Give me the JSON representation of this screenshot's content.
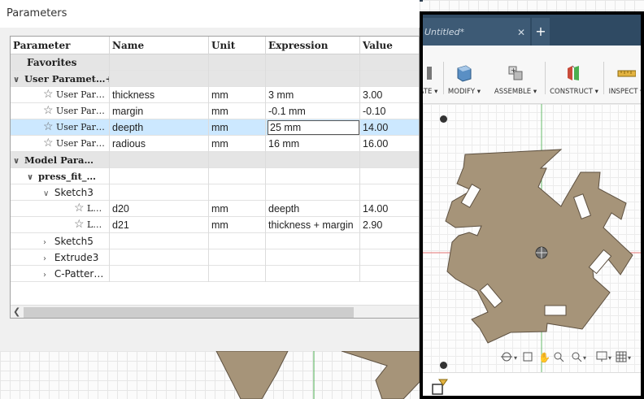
{
  "dialog": {
    "title": "Parameters",
    "columns": [
      "Parameter",
      "Name",
      "Unit",
      "Expression",
      "Value"
    ],
    "groups": {
      "favorites": "Favorites",
      "user_parameters": "User Paramet…",
      "model_parameters": "Model Para…",
      "component": "press_fit_…",
      "sketch3": "Sketch3",
      "sketch5": "Sketch5",
      "extrude3": "Extrude3",
      "cpattern": "C-Patter…"
    },
    "user_params": [
      {
        "param": "User Par…",
        "name": "thickness",
        "unit": "mm",
        "expression": "3 mm",
        "value": "3.00"
      },
      {
        "param": "User Par…",
        "name": "margin",
        "unit": "mm",
        "expression": "-0.1 mm",
        "value": "-0.10"
      },
      {
        "param": "User Par…",
        "name": "deepth",
        "unit": "mm",
        "expression": "25 mm",
        "value": "14.00"
      },
      {
        "param": "User Par…",
        "name": "radious",
        "unit": "mm",
        "expression": "16 mm",
        "value": "16.00"
      }
    ],
    "model_params": [
      {
        "param": "L…",
        "name": "d20",
        "unit": "mm",
        "expression": "deepth",
        "value": "14.00"
      },
      {
        "param": "L…",
        "name": "d21",
        "unit": "mm",
        "expression": "thickness + margin",
        "value": "2.90"
      }
    ]
  },
  "panel": {
    "tab_title": "Untitled*",
    "tab_close": "✕",
    "tab_add": "+",
    "toolbar": [
      {
        "label": "ATE ▾",
        "icon": "create-icon"
      },
      {
        "label": "MODIFY ▾",
        "icon": "modify-icon"
      },
      {
        "label": "ASSEMBLE ▾",
        "icon": "assemble-icon"
      },
      {
        "label": "CONSTRUCT ▾",
        "icon": "construct-icon"
      },
      {
        "label": "INSPECT ▾",
        "icon": "inspect-icon"
      }
    ]
  },
  "colors": {
    "part_fill": "#a69479",
    "part_stroke": "#5d5040",
    "axis_red": "#e05050",
    "axis_green": "#4caf50",
    "selection": "#cce8ff",
    "tabbar": "#2f4a63"
  }
}
